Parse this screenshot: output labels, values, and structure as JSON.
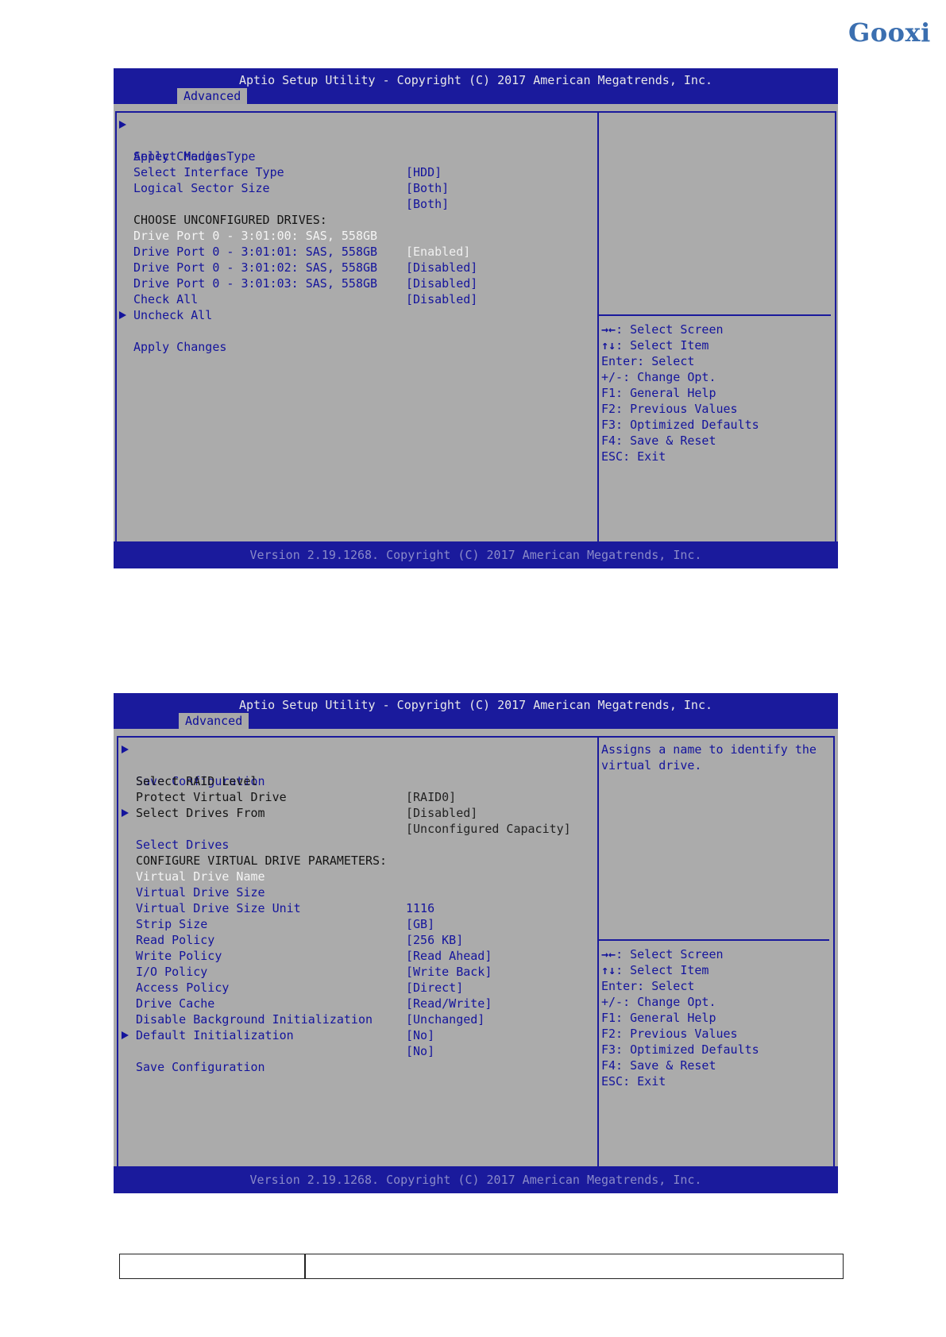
{
  "brand": {
    "logo_text": "Gooxi"
  },
  "screen1": {
    "title": "Aptio Setup Utility - Copyright (C) 2017 American Megatrends, Inc.",
    "tab": "Advanced",
    "footer": "Version 2.19.1268. Copyright (C) 2017 American Megatrends, Inc.",
    "items": [
      {
        "label": "Apply Changes",
        "value": "",
        "submenu": true
      },
      {
        "label": "Select Media Type",
        "value": "[HDD]",
        "submenu": false
      },
      {
        "label": "Select Interface Type",
        "value": "[Both]",
        "submenu": false
      },
      {
        "label": "Logical Sector Size",
        "value": "[Both]",
        "submenu": false
      }
    ],
    "section_heading": "CHOOSE UNCONFIGURED DRIVES:",
    "drives": [
      {
        "label": "Drive Port 0 - 3:01:00: SAS, 558GB",
        "value": "[Enabled]",
        "selected": true
      },
      {
        "label": "Drive Port 0 - 3:01:01: SAS, 558GB",
        "value": "[Disabled]",
        "selected": false
      },
      {
        "label": "Drive Port 0 - 3:01:02: SAS, 558GB",
        "value": "[Disabled]",
        "selected": false
      },
      {
        "label": "Drive Port 0 - 3:01:03: SAS, 558GB",
        "value": "[Disabled]",
        "selected": false
      }
    ],
    "actions": [
      {
        "label": "Check All",
        "submenu": false
      },
      {
        "label": "Uncheck All",
        "submenu": false
      },
      {
        "label": "Apply Changes",
        "submenu": true
      }
    ],
    "help_description": [],
    "keys": [
      {
        "key": "→←",
        "text": ": Select Screen"
      },
      {
        "key": "↑↓",
        "text": ": Select Item"
      },
      {
        "key": "",
        "text": "Enter: Select"
      },
      {
        "key": "",
        "text": "+/-: Change Opt."
      },
      {
        "key": "",
        "text": "F1: General Help"
      },
      {
        "key": "",
        "text": "F2: Previous Values"
      },
      {
        "key": "",
        "text": "F3: Optimized Defaults"
      },
      {
        "key": "",
        "text": "F4: Save & Reset"
      },
      {
        "key": "",
        "text": "ESC: Exit"
      }
    ]
  },
  "screen2": {
    "title": "Aptio Setup Utility - Copyright (C) 2017 American Megatrends, Inc.",
    "tab": "Advanced",
    "footer": "Version 2.19.1268. Copyright (C) 2017 American Megatrends, Inc.",
    "items": [
      {
        "label": "Save Configuration",
        "value": "",
        "submenu": true,
        "style": "blue"
      },
      {
        "label": "Select RAID Level",
        "value": "[RAID0]",
        "submenu": false,
        "style": "black"
      },
      {
        "label": "Protect Virtual Drive",
        "value": "[Disabled]",
        "submenu": false,
        "style": "black"
      },
      {
        "label": "Select Drives From",
        "value": "[Unconfigured Capacity]",
        "submenu": false,
        "style": "black"
      },
      {
        "label": "Select Drives",
        "value": "",
        "submenu": true,
        "style": "blue"
      }
    ],
    "section_heading": "CONFIGURE VIRTUAL DRIVE PARAMETERS:",
    "params": [
      {
        "label": "Virtual Drive Name",
        "value": "",
        "selected": true
      },
      {
        "label": "Virtual Drive Size",
        "value": "1116",
        "selected": false
      },
      {
        "label": "Virtual Drive Size Unit",
        "value": "[GB]",
        "selected": false
      },
      {
        "label": "Strip Size",
        "value": "[256 KB]",
        "selected": false
      },
      {
        "label": "Read Policy",
        "value": "[Read Ahead]",
        "selected": false
      },
      {
        "label": "Write Policy",
        "value": "[Write Back]",
        "selected": false
      },
      {
        "label": "I/O Policy",
        "value": "[Direct]",
        "selected": false
      },
      {
        "label": "Access Policy",
        "value": "[Read/Write]",
        "selected": false
      },
      {
        "label": "Drive Cache",
        "value": "[Unchanged]",
        "selected": false
      },
      {
        "label": "Disable Background Initialization",
        "value": "[No]",
        "selected": false
      },
      {
        "label": "Default Initialization",
        "value": "[No]",
        "selected": false
      }
    ],
    "final_action": {
      "label": "Save Configuration",
      "submenu": true
    },
    "help_description": [
      "Assigns a name to identify the",
      "virtual drive."
    ],
    "keys": [
      {
        "key": "→←",
        "text": ": Select Screen"
      },
      {
        "key": "↑↓",
        "text": ": Select Item"
      },
      {
        "key": "",
        "text": "Enter: Select"
      },
      {
        "key": "",
        "text": "+/-: Change Opt."
      },
      {
        "key": "",
        "text": "F1: General Help"
      },
      {
        "key": "",
        "text": "F2: Previous Values"
      },
      {
        "key": "",
        "text": "F3: Optimized Defaults"
      },
      {
        "key": "",
        "text": "F4: Save & Reset"
      },
      {
        "key": "",
        "text": "ESC: Exit"
      }
    ]
  },
  "bottom_table": {
    "cell_1": "",
    "cell_2": ""
  },
  "colors": {
    "bios_blue": "#1a1a9c",
    "bios_gray": "#ababab",
    "item_blue": "#14149c",
    "selected_white": "#f4f4f4",
    "logo_blue": "#3b6fb0"
  }
}
